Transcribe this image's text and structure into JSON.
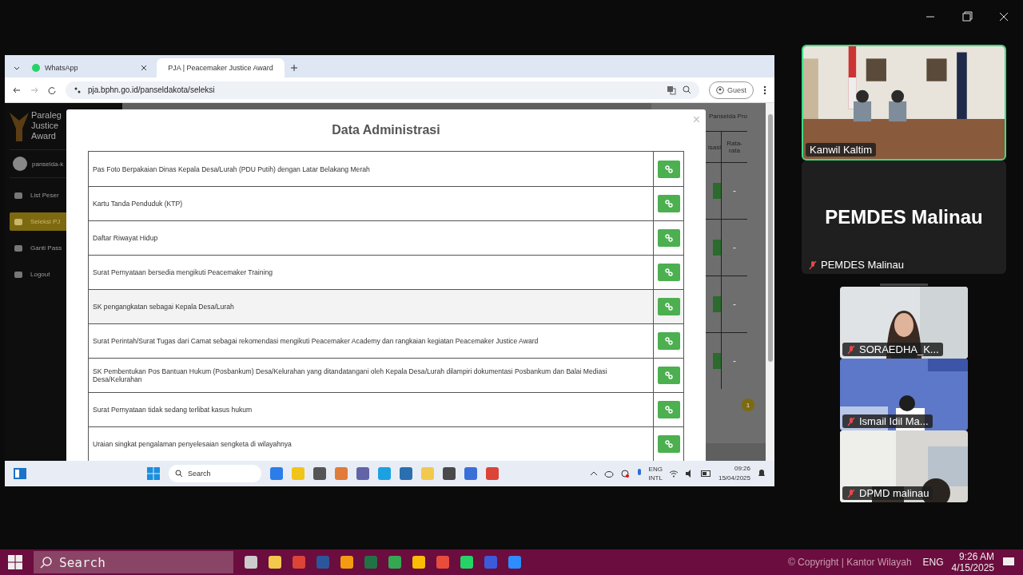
{
  "shared_screen": {
    "browser": {
      "tabs": [
        {
          "title": "WhatsApp",
          "selected": false
        },
        {
          "title": "PJA | Peacemaker Justice Award",
          "selected": true
        }
      ],
      "url": "pja.bphn.go.id/panseldakota/seleksi",
      "profile": "Guest"
    },
    "page": {
      "sidebar": {
        "brand": [
          "Paraleg",
          "Justice",
          "Award"
        ],
        "user": "panselda-k",
        "items": [
          {
            "label": "List Peser",
            "selected": false
          },
          {
            "label": "Seleksi PJ",
            "selected": true
          },
          {
            "label": "Ganti Pass",
            "selected": false
          },
          {
            "label": "Logout",
            "selected": false
          }
        ]
      },
      "table": {
        "header": "Panselda Pro",
        "columns": [
          "isasi",
          "Rata-rata"
        ],
        "rows": [
          "-",
          "-",
          "-",
          "-"
        ]
      },
      "pagination": "1"
    },
    "modal": {
      "title": "Data Administrasi",
      "close": "×",
      "documents": [
        {
          "label": "Pas Foto Berpakaian Dinas Kepala Desa/Lurah (PDU Putih) dengan Latar Belakang Merah",
          "highlighted": false
        },
        {
          "label": "Kartu Tanda Penduduk (KTP)",
          "highlighted": false
        },
        {
          "label": "Daftar Riwayat Hidup",
          "highlighted": false
        },
        {
          "label": "Surat Pernyataan bersedia mengikuti Peacemaker Training",
          "highlighted": false
        },
        {
          "label": "SK pengangkatan sebagai Kepala Desa/Lurah",
          "highlighted": true
        },
        {
          "label": "Surat Perintah/Surat Tugas dari Camat sebagai rekomendasi mengikuti Peacemaker Academy dan rangkaian kegiatan Peacemaker Justice Award",
          "highlighted": false
        },
        {
          "label": "SK Pembentukan Pos Bantuan Hukum (Posbankum) Desa/Kelurahan yang ditandatangani oleh Kepala Desa/Lurah dilampiri dokumentasi Posbankum dan Balai Mediasi Desa/Kelurahan",
          "highlighted": false
        },
        {
          "label": "Surat Pernyataan tidak sedang terlibat kasus hukum",
          "highlighted": false
        },
        {
          "label": "Uraian singkat pengalaman penyelesaian sengketa di wilayahnya",
          "highlighted": false
        }
      ]
    },
    "taskbar": {
      "search": "Search",
      "language": [
        "ENG",
        "INTL"
      ],
      "time": "09:26",
      "date": "15/04/2025"
    }
  },
  "participants": [
    {
      "name": "Kanwil Kaltim",
      "kind": "video",
      "muted": false,
      "speaking": true
    },
    {
      "name": "PEMDES Malinau",
      "display_name": "PEMDES Malinau",
      "kind": "name",
      "muted": true,
      "speaking": false
    },
    {
      "name": "SORAEDHA_K...",
      "kind": "video",
      "muted": true,
      "speaking": false
    },
    {
      "name": "Ismail Idil Ma...",
      "kind": "video",
      "muted": true,
      "speaking": false
    },
    {
      "name": "DPMD malinau",
      "kind": "video",
      "muted": true,
      "speaking": false
    }
  ],
  "taskbar": {
    "search": "Search",
    "copyright": "© Copyright | Kantor Wilayah",
    "language": "ENG",
    "time": "9:26 AM",
    "date": "4/15/2025"
  }
}
